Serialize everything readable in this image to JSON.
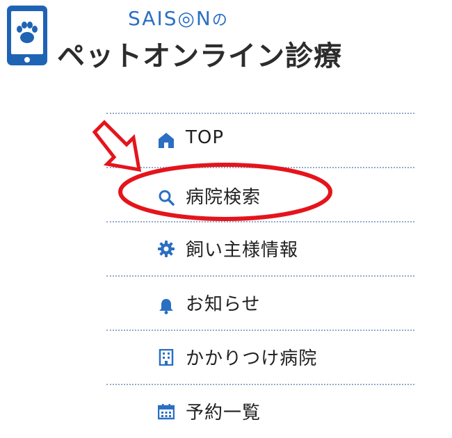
{
  "logo": {
    "brand": "SAIS◎N",
    "brand_suffix": "の",
    "title": "ペットオンライン診療",
    "icon": "smartphone-paw-icon"
  },
  "menu": {
    "items": [
      {
        "label": "TOP",
        "icon": "home-icon"
      },
      {
        "label": "病院検索",
        "icon": "search-icon"
      },
      {
        "label": "飼い主様情報",
        "icon": "gear-icon"
      },
      {
        "label": "お知らせ",
        "icon": "bell-icon"
      },
      {
        "label": "かかりつけ病院",
        "icon": "building-icon"
      },
      {
        "label": "予約一覧",
        "icon": "calendar-icon"
      }
    ]
  },
  "annotation": {
    "highlight_color": "#e5141b"
  },
  "colors": {
    "accent": "#2a6fc3",
    "divider": "#8fa9c8"
  }
}
